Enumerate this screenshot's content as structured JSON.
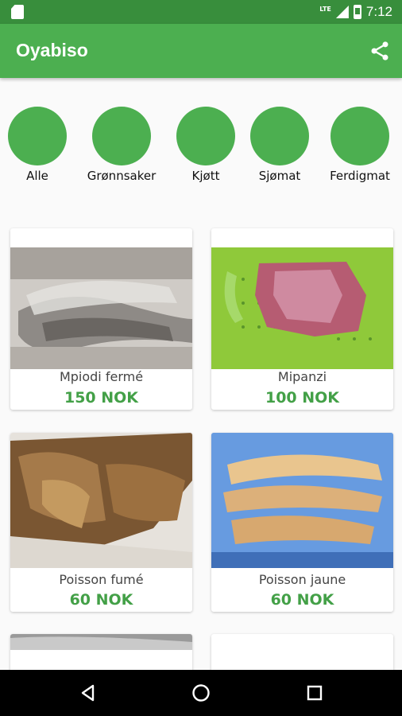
{
  "status_bar": {
    "network_label": "LTE",
    "time": "7:12"
  },
  "app_bar": {
    "title": "Oyabiso",
    "share_icon": "share-icon"
  },
  "categories": [
    {
      "label": "Alle"
    },
    {
      "label": "Grønnsaker"
    },
    {
      "label": "Kjøtt"
    },
    {
      "label": "Sjømat"
    },
    {
      "label": "Ferdigmat"
    }
  ],
  "products": [
    {
      "name": "Mpiodi fermé",
      "price": "150 NOK"
    },
    {
      "name": "Mipanzi",
      "price": "100 NOK"
    },
    {
      "name": "Poisson fumé",
      "price": "60 NOK"
    },
    {
      "name": "Poisson jaune",
      "price": "60 NOK"
    }
  ],
  "nav": {
    "back_icon": "back-triangle-icon",
    "home_icon": "home-circle-icon",
    "recents_icon": "recents-square-icon"
  },
  "colors": {
    "primary": "#4caf50",
    "primary_dark": "#388e3c",
    "price": "#43a047"
  }
}
